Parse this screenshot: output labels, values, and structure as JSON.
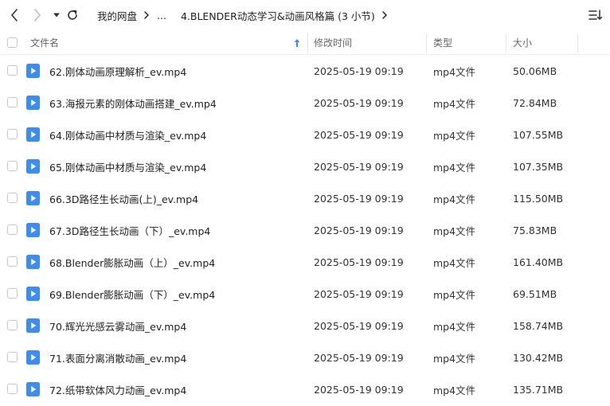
{
  "breadcrumb": {
    "root": "我的网盘",
    "ellipsis": "...",
    "current": "4.BLENDER动态学习&动画风格篇 (3 小节)"
  },
  "columns": {
    "name": "文件名",
    "modified": "修改时间",
    "type": "类型",
    "size": "大小"
  },
  "accent_color": "#3b8ef0",
  "files": [
    {
      "name": "62.刚体动画原理解析_ev.mp4",
      "modified": "2025-05-19 09:19",
      "type": "mp4文件",
      "size": "50.06MB"
    },
    {
      "name": "63.海报元素的刚体动画搭建_ev.mp4",
      "modified": "2025-05-19 09:19",
      "type": "mp4文件",
      "size": "72.84MB"
    },
    {
      "name": "64.刚体动画中材质与渲染_ev.mp4",
      "modified": "2025-05-19 09:19",
      "type": "mp4文件",
      "size": "107.55MB"
    },
    {
      "name": "65.刚体动画中材质与渲染_ev.mp4",
      "modified": "2025-05-19 09:19",
      "type": "mp4文件",
      "size": "107.35MB"
    },
    {
      "name": "66.3D路径生长动画(上)_ev.mp4",
      "modified": "2025-05-19 09:19",
      "type": "mp4文件",
      "size": "115.50MB"
    },
    {
      "name": "67.3D路径生长动画（下）_ev.mp4",
      "modified": "2025-05-19 09:19",
      "type": "mp4文件",
      "size": "75.83MB"
    },
    {
      "name": "68.Blender膨胀动画（上）_ev.mp4",
      "modified": "2025-05-19 09:19",
      "type": "mp4文件",
      "size": "161.40MB"
    },
    {
      "name": "69.Blender膨胀动画（下）_ev.mp4",
      "modified": "2025-05-19 09:19",
      "type": "mp4文件",
      "size": "69.51MB"
    },
    {
      "name": "70.辉光光感云雾动画_ev.mp4",
      "modified": "2025-05-19 09:19",
      "type": "mp4文件",
      "size": "158.74MB"
    },
    {
      "name": "71.表面分离消散动画_ev.mp4",
      "modified": "2025-05-19 09:19",
      "type": "mp4文件",
      "size": "130.42MB"
    },
    {
      "name": "72.纸带软体风力动画_ev.mp4",
      "modified": "2025-05-19 09:19",
      "type": "mp4文件",
      "size": "135.71MB"
    }
  ]
}
